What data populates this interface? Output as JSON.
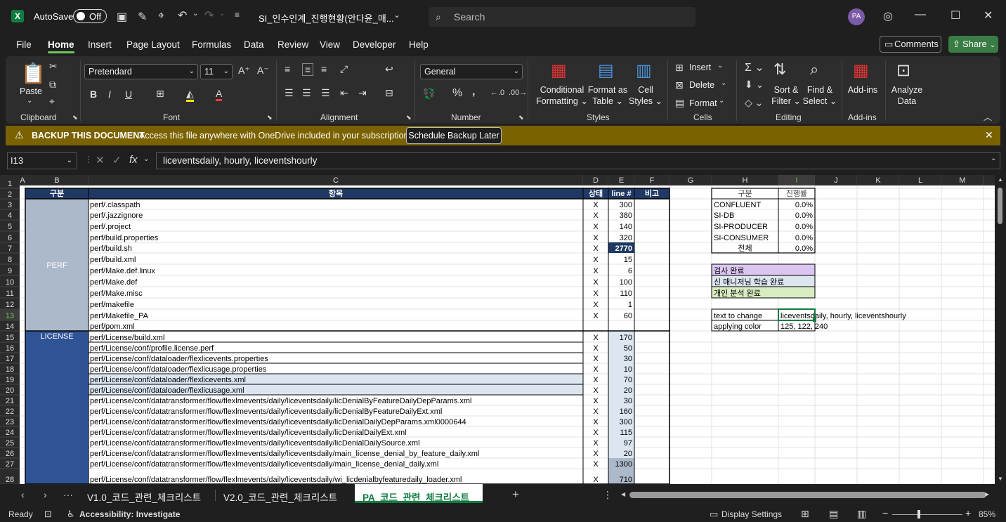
{
  "title": {
    "autosave_label": "AutoSave",
    "autosave_state": "Off",
    "filename": "SI_인수인계_진행현황(안다윤_매...",
    "search_placeholder": "Search",
    "avatar": "PA"
  },
  "menu": {
    "items": [
      "File",
      "Home",
      "Insert",
      "Page Layout",
      "Formulas",
      "Data",
      "Review",
      "View",
      "Developer",
      "Help"
    ],
    "comments": "Comments",
    "share": "Share"
  },
  "ribbon": {
    "clipboard": {
      "paste": "Paste",
      "label": "Clipboard"
    },
    "font": {
      "name": "Pretendard",
      "size": "11",
      "label": "Font",
      "bold": "B",
      "italic": "I",
      "underline": "U"
    },
    "alignment": {
      "label": "Alignment"
    },
    "number": {
      "format": "General",
      "label": "Number",
      "percent": "%",
      "comma": ","
    },
    "styles": {
      "conditional": "Conditional",
      "formatting": "Formatting",
      "format_as": "Format as",
      "table": "Table",
      "cell": "Cell",
      "styles": "Styles",
      "label": "Styles"
    },
    "cells": {
      "insert": "Insert",
      "delete": "Delete",
      "format": "Format",
      "label": "Cells"
    },
    "editing": {
      "sort": "Sort &",
      "filter": "Filter",
      "find": "Find &",
      "select": "Select",
      "label": "Editing"
    },
    "addins": {
      "addins": "Add-ins",
      "label": "Add-ins",
      "analyze": "Analyze",
      "data": "Data"
    }
  },
  "banner": {
    "title": "BACKUP THIS DOCUMENT",
    "message": "Access this file anywhere with OneDrive included in your subscription.",
    "button": "Schedule Backup Later"
  },
  "formula_bar": {
    "cell_ref": "I13",
    "fx": "fx",
    "content": "liceventsdaily, hourly, liceventshourly"
  },
  "grid": {
    "columns": [
      "A",
      "B",
      "C",
      "D",
      "E",
      "F",
      "G",
      "H",
      "I",
      "J",
      "K",
      "L",
      "M"
    ],
    "rows": [
      "1",
      "2",
      "3",
      "4",
      "5",
      "6",
      "7",
      "8",
      "9",
      "10",
      "11",
      "12",
      "13",
      "14",
      "15",
      "16",
      "17",
      "18",
      "19",
      "20",
      "21",
      "22",
      "23",
      "24",
      "25",
      "26",
      "27",
      "28"
    ],
    "header": {
      "b": "구분",
      "c": "항목",
      "d": "상태",
      "e": "line #",
      "f": "비고"
    },
    "group_perf": "PERF",
    "group_license": "LICENSE",
    "items": [
      {
        "c": "perf/.classpath",
        "d": "X",
        "e": "300"
      },
      {
        "c": "perf/.jazzignore",
        "d": "X",
        "e": "380"
      },
      {
        "c": "perf/.project",
        "d": "X",
        "e": "140"
      },
      {
        "c": "perf/build.properties",
        "d": "X",
        "e": "320"
      },
      {
        "c": "perf/build.sh",
        "d": "X",
        "e": "2770"
      },
      {
        "c": "perf/build.xml",
        "d": "X",
        "e": "15"
      },
      {
        "c": "perf/Make.def.linux",
        "d": "X",
        "e": "6"
      },
      {
        "c": "perf/Make.def",
        "d": "X",
        "e": "100"
      },
      {
        "c": "perf/Make.misc",
        "d": "X",
        "e": "110"
      },
      {
        "c": "perf/makefile",
        "d": "X",
        "e": "1"
      },
      {
        "c": "perf/Makefile_PA",
        "d": "X",
        "e": "60"
      },
      {
        "c": "perf/pom.xml",
        "d": "",
        "e": ""
      },
      {
        "c": "perf/License/build.xml",
        "d": "X",
        "e": "170"
      },
      {
        "c": "perf/License/conf/profile.license.perf",
        "d": "X",
        "e": "50"
      },
      {
        "c": "perf/License/conf/dataloader/flexlicevents.properties",
        "d": "X",
        "e": "30"
      },
      {
        "c": "perf/License/conf/dataloader/flexlicusage.properties",
        "d": "X",
        "e": "10"
      },
      {
        "c": "perf/License/conf/dataloader/flexlicevents.xml",
        "d": "X",
        "e": "70"
      },
      {
        "c": "perf/License/conf/dataloader/flexlicusage.xml",
        "d": "X",
        "e": "20"
      },
      {
        "c": "perf/License/conf/datatransformer/flow/flexlmevents/daily/liceventsdaily/licDenialByFeatureDailyDepParams.xml",
        "d": "X",
        "e": "30"
      },
      {
        "c": "perf/License/conf/datatransformer/flow/flexlmevents/daily/liceventsdaily/licDenialByFeatureDailyExt.xml",
        "d": "X",
        "e": "160"
      },
      {
        "c": "perf/License/conf/datatransformer/flow/flexlmevents/daily/liceventsdaily/licDenialDailyDepParams.xml0000644",
        "d": "X",
        "e": "300"
      },
      {
        "c": "perf/License/conf/datatransformer/flow/flexlmevents/daily/liceventsdaily/licDenialDailyExt.xml",
        "d": "X",
        "e": "115"
      },
      {
        "c": "perf/License/conf/datatransformer/flow/flexlmevents/daily/liceventsdaily/licDenialDailySource.xml",
        "d": "X",
        "e": "97"
      },
      {
        "c": "perf/License/conf/datatransformer/flow/flexlmevents/daily/liceventsdaily/main_license_denial_by_feature_daily.xml",
        "d": "X",
        "e": "20"
      },
      {
        "c": "perf/License/conf/datatransformer/flow/flexlmevents/daily/liceventsdaily/main_license_denial_daily.xml",
        "d": "X",
        "e": "1300"
      },
      {
        "c": "perf/License/conf/datatransformer/flow/flexlmevents/daily/liceventsdaily/wi_licdenialbyfeaturedaily_loader.xml",
        "d": "X",
        "e": "710"
      }
    ],
    "summary_header": {
      "h": "구분",
      "i": "진행률"
    },
    "summary": [
      {
        "h": "CONFLUENT",
        "i": "0.0%"
      },
      {
        "h": "SI-DB",
        "i": "0.0%"
      },
      {
        "h": "SI-PRODUCER",
        "i": "0.0%"
      },
      {
        "h": "SI-CONSUMER",
        "i": "0.0%"
      },
      {
        "h": "전체",
        "i": "0.0%"
      }
    ],
    "legend": [
      "검사 완료",
      "신 매니저님 학습 완료",
      "개인 분석 완료"
    ],
    "text_to_change_label": "text to change",
    "text_to_change_value": "liceventsdaily, hourly, liceventshourly",
    "applying_color_label": "applying color",
    "applying_color_value": "125, 122, 240"
  },
  "tabs": {
    "sheets": [
      "V1.0_코드_관련_체크리스트",
      "V2.0_코드_관련_체크리스트",
      "PA_코드_관련_체크리스트"
    ],
    "active": "PA_코드_관련_체크리스트"
  },
  "status": {
    "ready": "Ready",
    "accessibility": "Accessibility: Investigate",
    "display": "Display Settings",
    "zoom": "85%"
  },
  "colors": {
    "header_fill": "#1f3864",
    "perf_fill": "#acb9ca",
    "license_fill": "#2f5496",
    "lightblue": "#dce6f1",
    "lavender": "#dcc6f0",
    "lightgreen": "#d8ecc2",
    "banner": "#7a6200",
    "accent": "#107c41"
  }
}
